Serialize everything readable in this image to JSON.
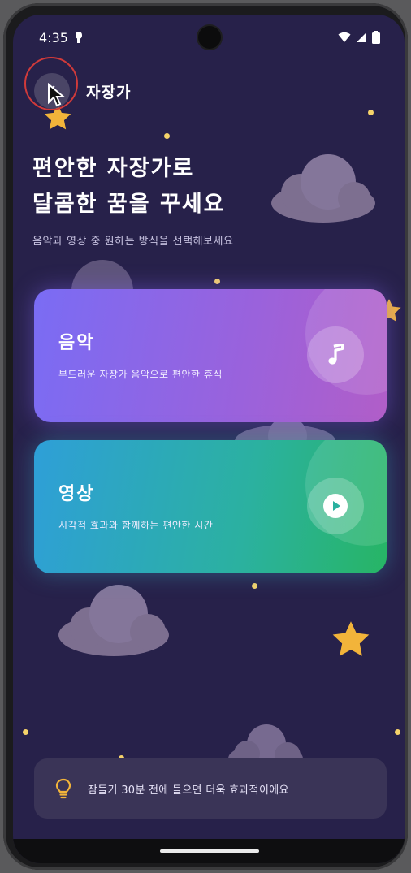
{
  "status_bar": {
    "time": "4:35"
  },
  "header": {
    "title": "자장가"
  },
  "hero": {
    "title_line1": "편안한 자장가로",
    "title_line2": "달콤한 꿈을 꾸세요",
    "subtitle": "음악과 영상 중 원하는 방식을 선택해보세요"
  },
  "cards": [
    {
      "title": "음악",
      "description": "부드러운 자장가 음악으로 편안한 휴식",
      "icon": "music-note-icon",
      "colors": [
        "#7a6cf4",
        "#b15ec8"
      ]
    },
    {
      "title": "영상",
      "description": "시각적 효과와 함께하는 편안한 시간",
      "icon": "play-icon",
      "colors": [
        "#2e9fd8",
        "#27b565"
      ]
    }
  ],
  "tip": {
    "icon": "lightbulb-icon",
    "text": "잠들기 30분 전에 들으면 더욱 효과적이에요"
  },
  "colors": {
    "background": "#27214a",
    "star": "#f2b43a",
    "cloud": "#7b6d8e"
  }
}
